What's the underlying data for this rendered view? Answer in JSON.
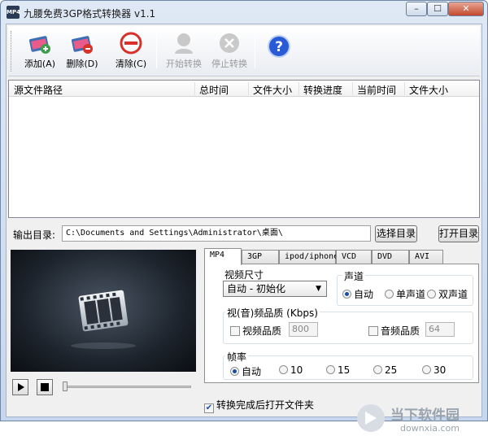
{
  "window": {
    "title": "九腰免费3GP格式转换器 v1.1",
    "icon_text": "MP4",
    "controls": {
      "minimize": "–",
      "maximize": "☐",
      "close": "✕"
    }
  },
  "toolbar": {
    "add": "添加(A)",
    "delete": "删除(D)",
    "clear": "清除(C)",
    "start": "开始转换",
    "stop": "停止转换"
  },
  "file_list": {
    "columns": [
      "源文件路径",
      "总时间",
      "文件大小",
      "转换进度",
      "当前时间",
      "文件大小"
    ],
    "rows": []
  },
  "output": {
    "label": "输出目录:",
    "path": "C:\\Documents and Settings\\Administrator\\桌面\\",
    "choose_button": "选择目录",
    "open_button": "打开目录"
  },
  "player": {
    "seek_position": 0
  },
  "tabs": [
    "MP4",
    "3GP",
    "ipod/iphone",
    "VCD",
    "DVD",
    "AVI"
  ],
  "active_tab": "MP4",
  "video_size": {
    "label": "视频尺寸",
    "value": "自动 - 初始化"
  },
  "audio_channel": {
    "label": "声道",
    "options": [
      "自动",
      "单声道",
      "双声道"
    ],
    "selected": "自动"
  },
  "quality": {
    "label": "视(音)频品质 (Kbps)",
    "video_label": "视频品质",
    "video_value": "800",
    "audio_label": "音频品质",
    "audio_value": "64"
  },
  "frame_rate": {
    "label": "帧率",
    "options": [
      "自动",
      "10",
      "15",
      "25",
      "30"
    ],
    "selected": "自动"
  },
  "open_after": {
    "label": "转换完成后打开文件夹",
    "checked": true
  },
  "watermark": {
    "cn": "当下软件园",
    "url": "downxia.com"
  },
  "colors": {
    "accent": "#1c4ea0",
    "help_blue": "#2a5bd7"
  }
}
